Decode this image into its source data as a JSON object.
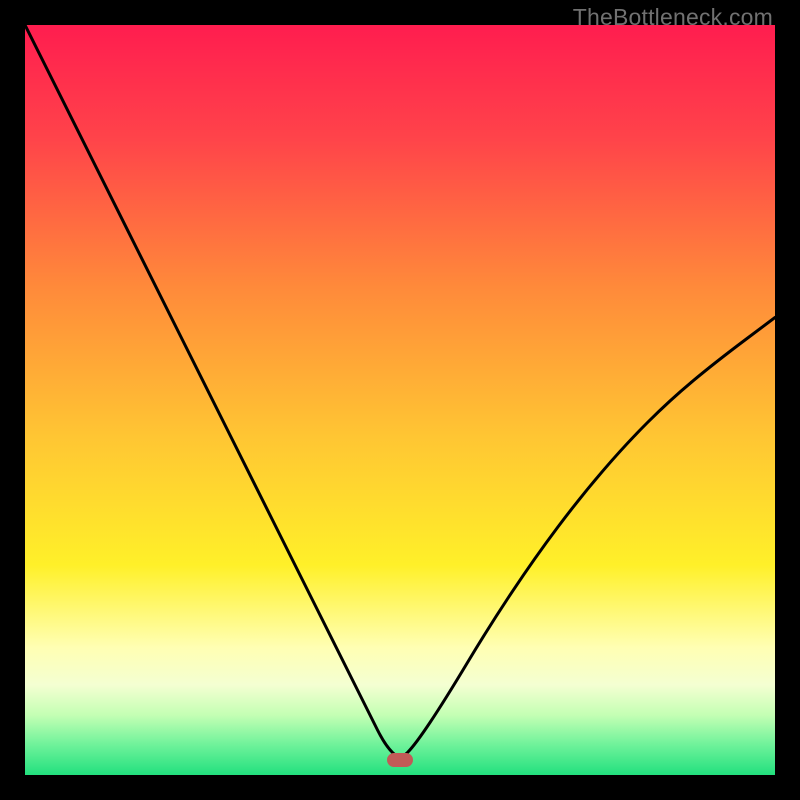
{
  "watermark": "TheBottleneck.com",
  "chart_data": {
    "type": "line",
    "description": "Absolute-value style V-curve on a red→orange→yellow→light→green vertical gradient background, framed by a black border. A small rounded red marker sits at the curve's dip near the bottom.",
    "xlim": [
      0,
      100
    ],
    "ylim": [
      0,
      100
    ],
    "title": "",
    "xlabel": "",
    "ylabel": "",
    "grid": false,
    "legend": false,
    "x": [
      0,
      6,
      12,
      18,
      24,
      30,
      36,
      42,
      46,
      48,
      50,
      52,
      56,
      62,
      68,
      74,
      80,
      86,
      92,
      100
    ],
    "y": [
      100,
      88,
      76,
      64,
      52,
      40,
      28,
      16,
      8,
      4,
      2,
      4,
      10,
      20,
      29,
      37,
      44,
      50,
      55,
      61
    ],
    "vertex": {
      "x": 50,
      "y": 2
    },
    "marker": {
      "x": 50,
      "y": 2,
      "shape": "rounded-rect",
      "color": "#c15a57"
    },
    "background_gradient": [
      {
        "stop": 0.0,
        "color": "#ff1d4f"
      },
      {
        "stop": 0.15,
        "color": "#ff434a"
      },
      {
        "stop": 0.35,
        "color": "#ff8a3a"
      },
      {
        "stop": 0.55,
        "color": "#ffc633"
      },
      {
        "stop": 0.72,
        "color": "#fff029"
      },
      {
        "stop": 0.83,
        "color": "#ffffb3"
      },
      {
        "stop": 0.88,
        "color": "#f4ffd2"
      },
      {
        "stop": 0.92,
        "color": "#c4ffb4"
      },
      {
        "stop": 0.96,
        "color": "#6ef29a"
      },
      {
        "stop": 1.0,
        "color": "#22e07e"
      }
    ]
  }
}
